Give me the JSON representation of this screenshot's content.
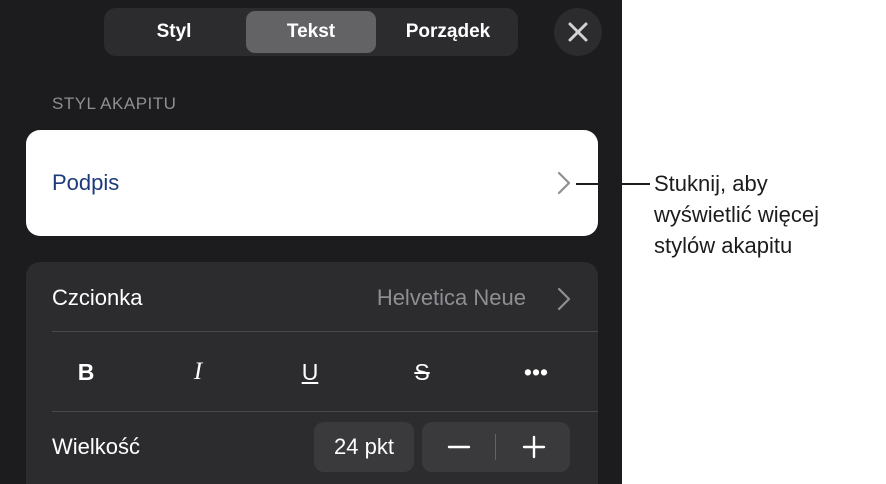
{
  "tabs": [
    {
      "label": "Styl",
      "active": false
    },
    {
      "label": "Tekst",
      "active": true
    },
    {
      "label": "Porządek",
      "active": false
    }
  ],
  "close_icon": "close-icon",
  "paragraph_style": {
    "section_label": "STYL AKAPITU",
    "current": "Podpis"
  },
  "font": {
    "label": "Czcionka",
    "value": "Helvetica Neue"
  },
  "format_buttons": {
    "bold": "B",
    "italic": "I",
    "underline": "U",
    "strikethrough": "S",
    "more": "•••"
  },
  "size": {
    "label": "Wielkość",
    "value": "24 pkt"
  },
  "callout": "Stuknij, aby\nwyświetlić więcej\nstylów akapitu",
  "colors": {
    "panel_bg": "#1c1c1e",
    "card_bg": "#2c2c2e",
    "style_text": "#1d3a7a",
    "secondary_text": "#8e8e93"
  }
}
